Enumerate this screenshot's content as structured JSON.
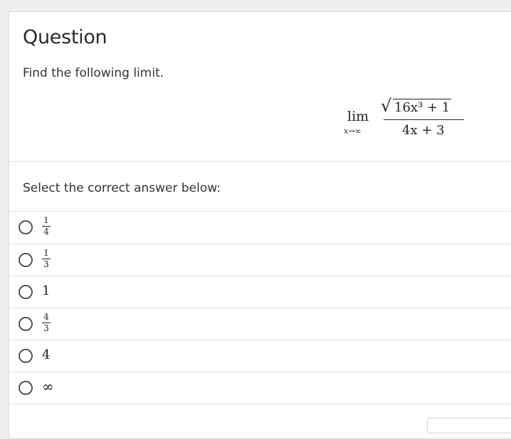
{
  "question": {
    "title": "Question",
    "prompt": "Find the following limit."
  },
  "formula": {
    "lim": "lim",
    "subscript": "x→∞",
    "radical_symbol": "√",
    "numerator": "16x³ + 1",
    "denominator": "4x + 3"
  },
  "answers": {
    "label": "Select the correct answer below:",
    "options": [
      {
        "kind": "fraction",
        "numerator": "1",
        "denominator": "4"
      },
      {
        "kind": "fraction",
        "numerator": "1",
        "denominator": "3"
      },
      {
        "kind": "plain",
        "value": "1"
      },
      {
        "kind": "fraction",
        "numerator": "4",
        "denominator": "3"
      },
      {
        "kind": "plain",
        "value": "4"
      },
      {
        "kind": "plain",
        "value": "∞"
      }
    ]
  }
}
